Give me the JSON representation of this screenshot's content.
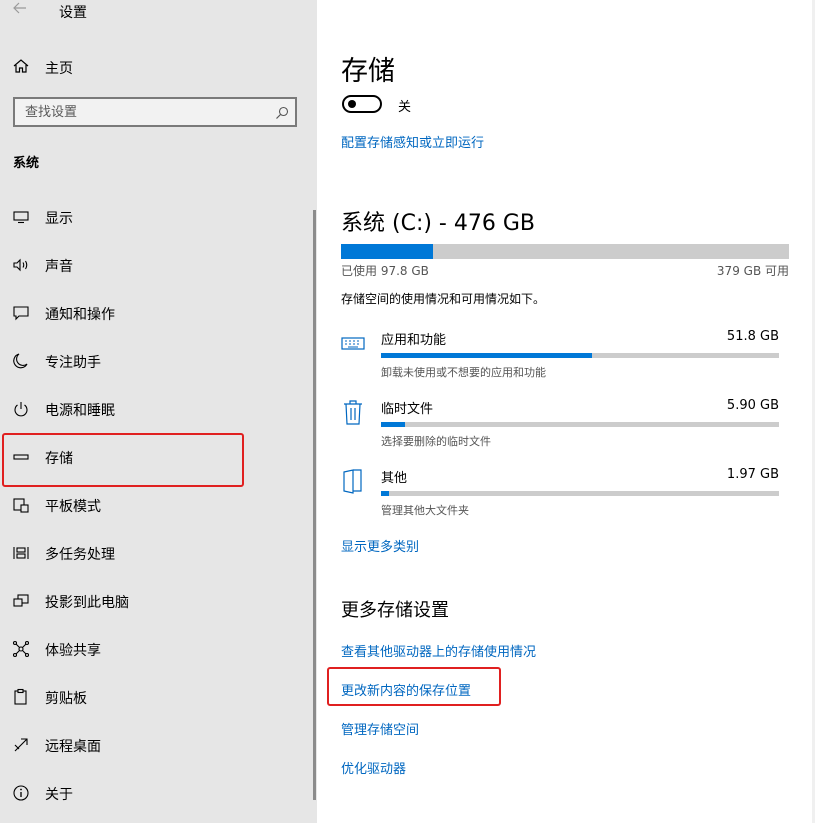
{
  "window": {
    "title": "设置"
  },
  "sidebar": {
    "home_label": "主页",
    "search_placeholder": "查找设置",
    "section_label": "系统",
    "items": [
      {
        "label": "显示",
        "icon": "monitor-icon"
      },
      {
        "label": "声音",
        "icon": "speaker-icon"
      },
      {
        "label": "通知和操作",
        "icon": "message-icon"
      },
      {
        "label": "专注助手",
        "icon": "moon-icon"
      },
      {
        "label": "电源和睡眠",
        "icon": "power-icon"
      },
      {
        "label": "存储",
        "icon": "drive-icon",
        "selected": true
      },
      {
        "label": "平板模式",
        "icon": "tablet-icon"
      },
      {
        "label": "多任务处理",
        "icon": "multitask-icon"
      },
      {
        "label": "投影到此电脑",
        "icon": "project-icon"
      },
      {
        "label": "体验共享",
        "icon": "share-icon"
      },
      {
        "label": "剪贴板",
        "icon": "clipboard-icon"
      },
      {
        "label": "远程桌面",
        "icon": "remote-icon"
      },
      {
        "label": "关于",
        "icon": "info-icon"
      }
    ]
  },
  "main": {
    "title": "存储",
    "toggle_label": "关",
    "toggle_on": false,
    "configure_link": "配置存储感知或立即运行",
    "drive": {
      "title": "系统 (C:) - 476 GB",
      "used": "已使用 97.8 GB",
      "free": "379 GB 可用",
      "used_fraction": 0.205
    },
    "description": "存储空间的使用情况和可用情况如下。",
    "categories": [
      {
        "name": "应用和功能",
        "size": "51.8 GB",
        "sub": "卸载未使用或不想要的应用和功能",
        "fraction": 0.53,
        "icon": "keyboard-icon"
      },
      {
        "name": "临时文件",
        "size": "5.90 GB",
        "sub": "选择要删除的临时文件",
        "fraction": 0.06,
        "icon": "trash-icon"
      },
      {
        "name": "其他",
        "size": "1.97 GB",
        "sub": "管理其他大文件夹",
        "fraction": 0.02,
        "icon": "folder-icon"
      }
    ],
    "show_more_link": "显示更多类别",
    "more_heading": "更多存储设置",
    "links": [
      "查看其他驱动器上的存储使用情况",
      "更改新内容的保存位置",
      "管理存储空间",
      "优化驱动器"
    ]
  },
  "colors": {
    "accent": "#0078d7",
    "link": "#0067c0",
    "highlight": "#e02020",
    "sidebar_bg": "#e6e6e6"
  }
}
